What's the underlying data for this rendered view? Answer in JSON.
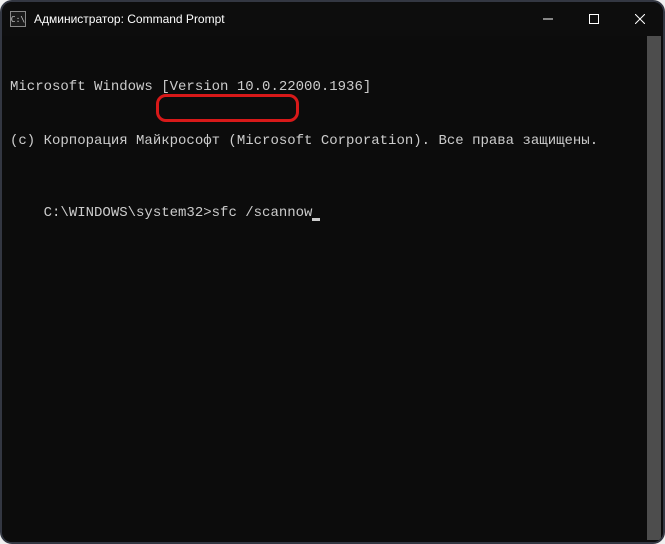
{
  "titlebar": {
    "icon_label": "C:\\",
    "title": "Администратор: Command Prompt"
  },
  "terminal": {
    "line1": "Microsoft Windows [Version 10.0.22000.1936]",
    "line2": "(c) Корпорация Майкрософт (Microsoft Corporation). Все права защищены.",
    "blank": "",
    "prompt": "C:\\WINDOWS\\system32>",
    "command": "sfc /scannow"
  },
  "highlight": {
    "color": "#d81919"
  }
}
